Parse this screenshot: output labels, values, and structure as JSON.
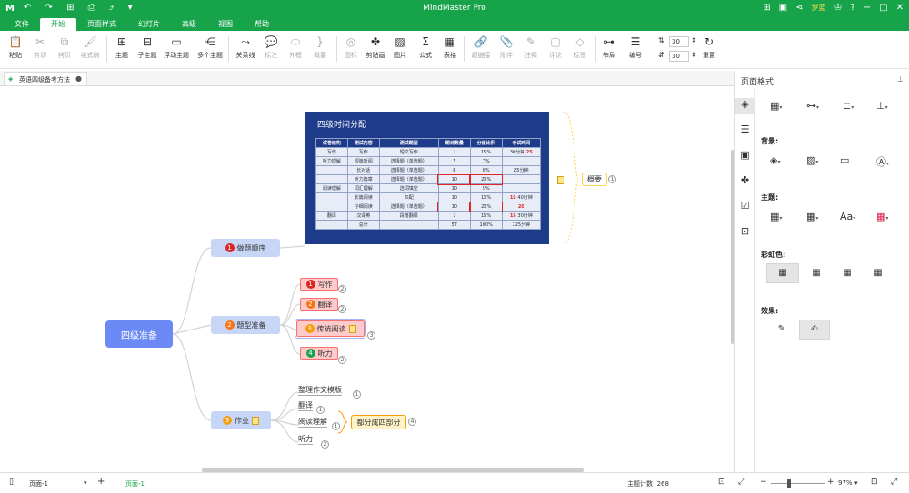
{
  "app": {
    "title": "MindMaster Pro",
    "user": "梦蓝",
    "logo": "M"
  },
  "tabs": [
    "文件",
    "开始",
    "页面样式",
    "幻灯片",
    "高级",
    "视图",
    "帮助"
  ],
  "active_tab": "开始",
  "ribbon": {
    "paste": "粘贴",
    "cut": "剪切",
    "copy": "拷贝",
    "format_brush": "格式刷",
    "topic": "主题",
    "subtopic": "子主题",
    "floating": "浮动主题",
    "multi": "多个主题",
    "relation": "关系线",
    "callout": "标注",
    "outline": "外框",
    "summary": "概要",
    "icon": "图标",
    "clipart": "剪贴画",
    "image": "图片",
    "formula": "公式",
    "table": "表格",
    "hyperlink": "超链接",
    "attachment": "附件",
    "note": "注释",
    "comment": "评论",
    "tag": "标签",
    "layout": "布局",
    "numbering": "编号",
    "font_size_1": "30",
    "font_size_2": "30",
    "reset": "重置"
  },
  "doc_tab": {
    "name": "英语四级备考方法"
  },
  "mindmap": {
    "root": "四级准备",
    "branch1": {
      "label": "做题顺序",
      "num": "1",
      "color": "#dc2626"
    },
    "branch2": {
      "label": "题型准备",
      "num": "2",
      "color": "#f97316"
    },
    "branch3": {
      "label": "作业",
      "num": "3",
      "color": "#f59e0b"
    },
    "b2_children": [
      {
        "label": "写作",
        "num": "1",
        "color": "#dc2626",
        "badge": "2"
      },
      {
        "label": "翻译",
        "num": "2",
        "color": "#f97316",
        "badge": "2"
      },
      {
        "label": "传统阅读",
        "num": "3",
        "color": "#f59e0b",
        "badge": "3"
      },
      {
        "label": "听力",
        "num": "4",
        "color": "#16a34a",
        "badge": "2"
      }
    ],
    "b3_children": [
      {
        "label": "整理作文模版",
        "badge": "1"
      },
      {
        "label": "翻译",
        "badge": "1"
      },
      {
        "label": "阅读理解",
        "badge": "1"
      },
      {
        "label": "听力",
        "badge": "2"
      }
    ],
    "b3_summary": {
      "label": "都分成四部分",
      "badge": "4"
    },
    "summary": {
      "label": "概要",
      "badge": "1"
    }
  },
  "embedded_image": {
    "title": "四级时间分配",
    "headers": [
      "试卷结构",
      "测试内容",
      "测试题型",
      "题目数量",
      "分值比例",
      "考试时间"
    ],
    "rows": [
      [
        "写作",
        "写作",
        "短文写作",
        "1",
        "15%",
        "30分钟"
      ],
      [
        "听力理解",
        "短篇新闻",
        "选择题（单选题）",
        "7",
        "7%",
        ""
      ],
      [
        "",
        "长对话",
        "选择题（单选题）",
        "8",
        "8%",
        "25分钟"
      ],
      [
        "",
        "听力篇章",
        "选择题（单选题）",
        "10",
        "20%",
        ""
      ],
      [
        "阅读理解",
        "词汇理解",
        "选词填空",
        "10",
        "5%",
        ""
      ],
      [
        "",
        "长篇阅读",
        "匹配",
        "10",
        "10%",
        "40分钟"
      ],
      [
        "",
        "仔细阅读",
        "选择题（单选题）",
        "10",
        "20%",
        ""
      ],
      [
        "翻译",
        "汉译英",
        "段落翻译",
        "1",
        "15%",
        "30分钟"
      ],
      [
        "",
        "总计",
        "",
        "57",
        "100%",
        "125分钟"
      ]
    ],
    "annotations": [
      "25",
      "15",
      "20",
      "15"
    ]
  },
  "right_panel": {
    "title": "页面格式",
    "sections": {
      "background": "背景:",
      "theme": "主题:",
      "rainbow": "彩虹色:",
      "effect": "效果:"
    }
  },
  "status": {
    "page_selector": "页面-1",
    "page_tab": "页面-1",
    "topic_count": "主题计数: 268",
    "zoom": "97%"
  }
}
